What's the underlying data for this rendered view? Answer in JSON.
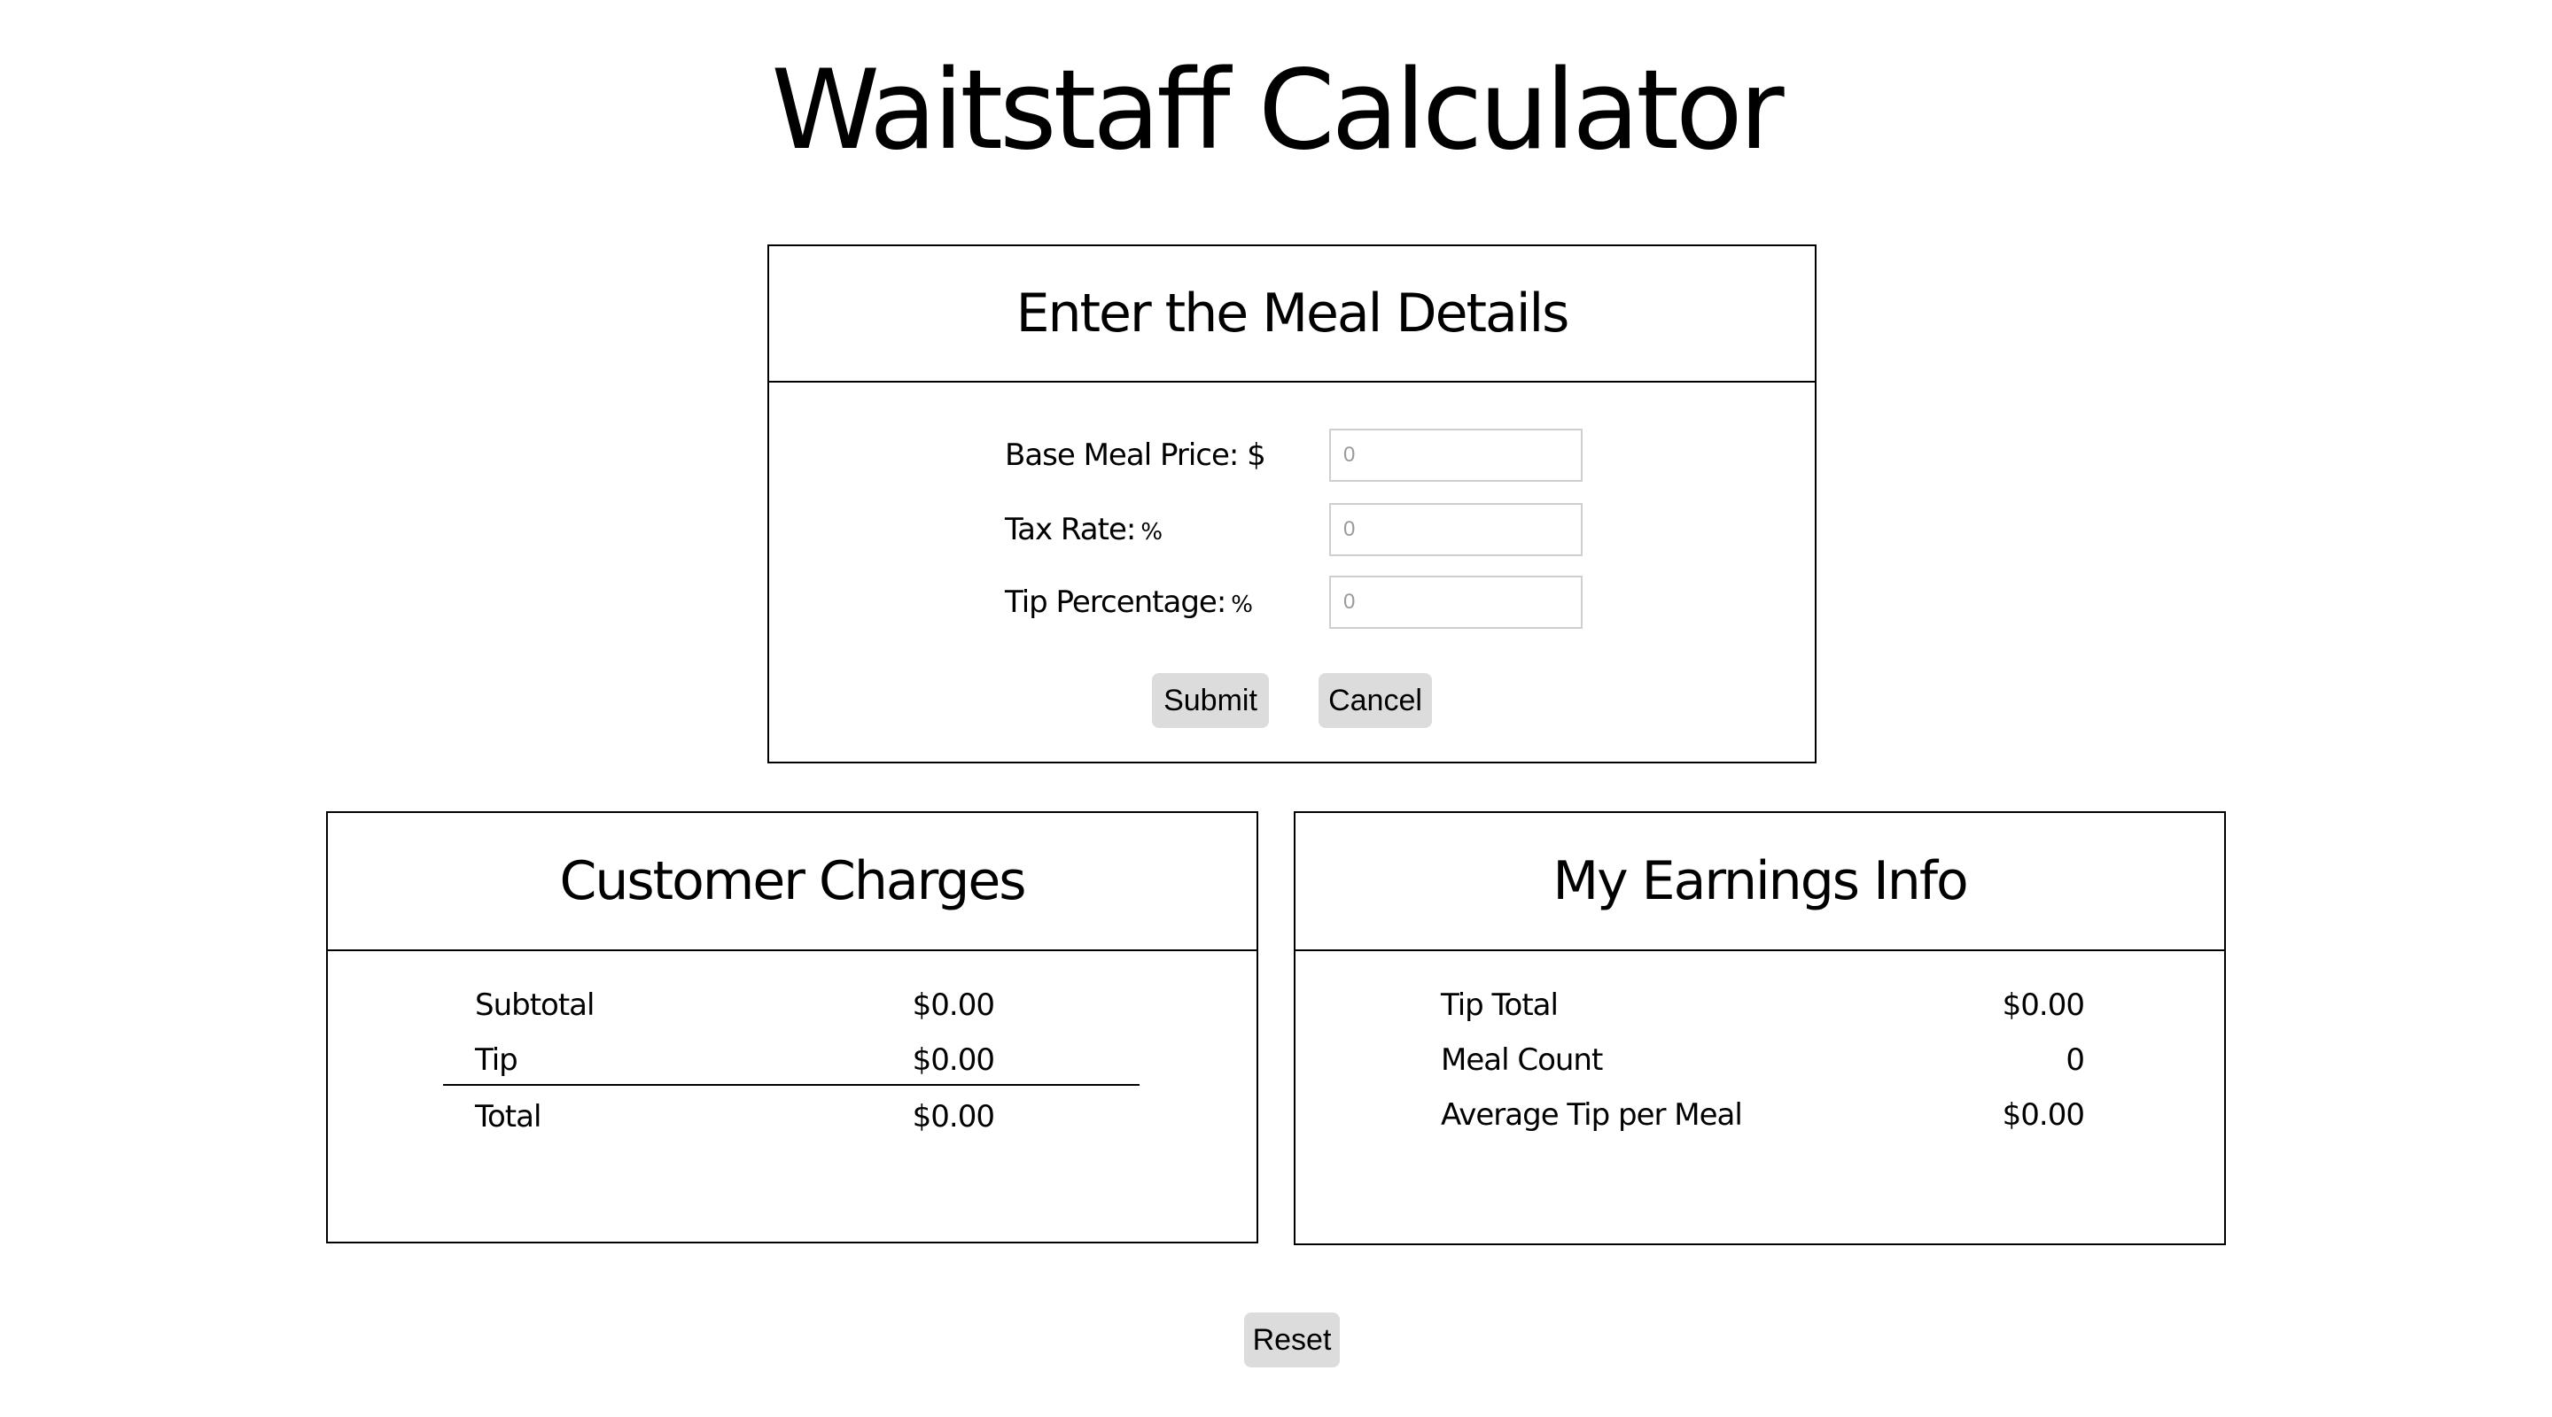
{
  "page": {
    "title": "Waitstaff Calculator"
  },
  "meal_details": {
    "heading": "Enter the Meal Details",
    "fields": [
      {
        "label": "Base Meal Price: $",
        "unit": "",
        "placeholder": "0",
        "value": ""
      },
      {
        "label": "Tax Rate:",
        "unit": "%",
        "placeholder": "0",
        "value": ""
      },
      {
        "label": "Tip Percentage:",
        "unit": "%",
        "placeholder": "0",
        "value": ""
      }
    ],
    "submit_label": "Submit",
    "cancel_label": "Cancel"
  },
  "customer_charges": {
    "heading": "Customer Charges",
    "rows": [
      {
        "label": "Subtotal",
        "value": "$0.00"
      },
      {
        "label": "Tip",
        "value": "$0.00"
      },
      {
        "label": "Total",
        "value": "$0.00"
      }
    ]
  },
  "earnings": {
    "heading": "My Earnings Info",
    "rows": [
      {
        "label": "Tip Total",
        "value": "$0.00"
      },
      {
        "label": "Meal Count",
        "value": "0"
      },
      {
        "label": "Average Tip per Meal",
        "value": "$0.00"
      }
    ]
  },
  "reset_label": "Reset"
}
